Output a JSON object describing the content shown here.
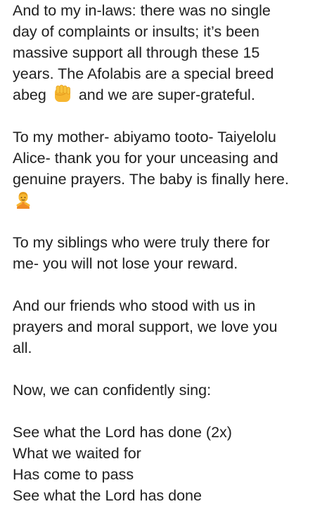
{
  "post": {
    "inlaws": {
      "line1": "And to my in-laws: there was no single",
      "line2": "day of complaints or insults; it’s been",
      "line3": "massive support all through these 15",
      "line4": "years. The Afolabis are a special breed",
      "line5_before": "abeg",
      "line5_emoji": "raised-fist-emoji",
      "line5_after": "and we are super-grateful."
    },
    "mother": {
      "line1": "To my mother- abiyamo tooto- Taiyelolu",
      "line2": "Alice- thank you for your unceasing and",
      "line3": "genuine prayers. The baby is finally here.",
      "line4_emoji": "person-gesturing-emoji"
    },
    "siblings": {
      "line1": "To my siblings who were truly there for",
      "line2": "me- you will not lose your reward."
    },
    "friends": {
      "line1": "And our friends who stood with us in",
      "line2": "prayers and moral support, we love you",
      "line3": "all."
    },
    "sing": {
      "line1": "Now, we can confidently sing:"
    },
    "song": {
      "line1": "See what the Lord has done (2x)",
      "line2": "What we waited for",
      "line3": "Has come to pass",
      "line4": "See what the Lord has done"
    }
  },
  "colors": {
    "text": "#1f1f1f",
    "background": "#ffffff",
    "emoji_yellow": "#f7b731",
    "emoji_orange": "#f08a24"
  }
}
